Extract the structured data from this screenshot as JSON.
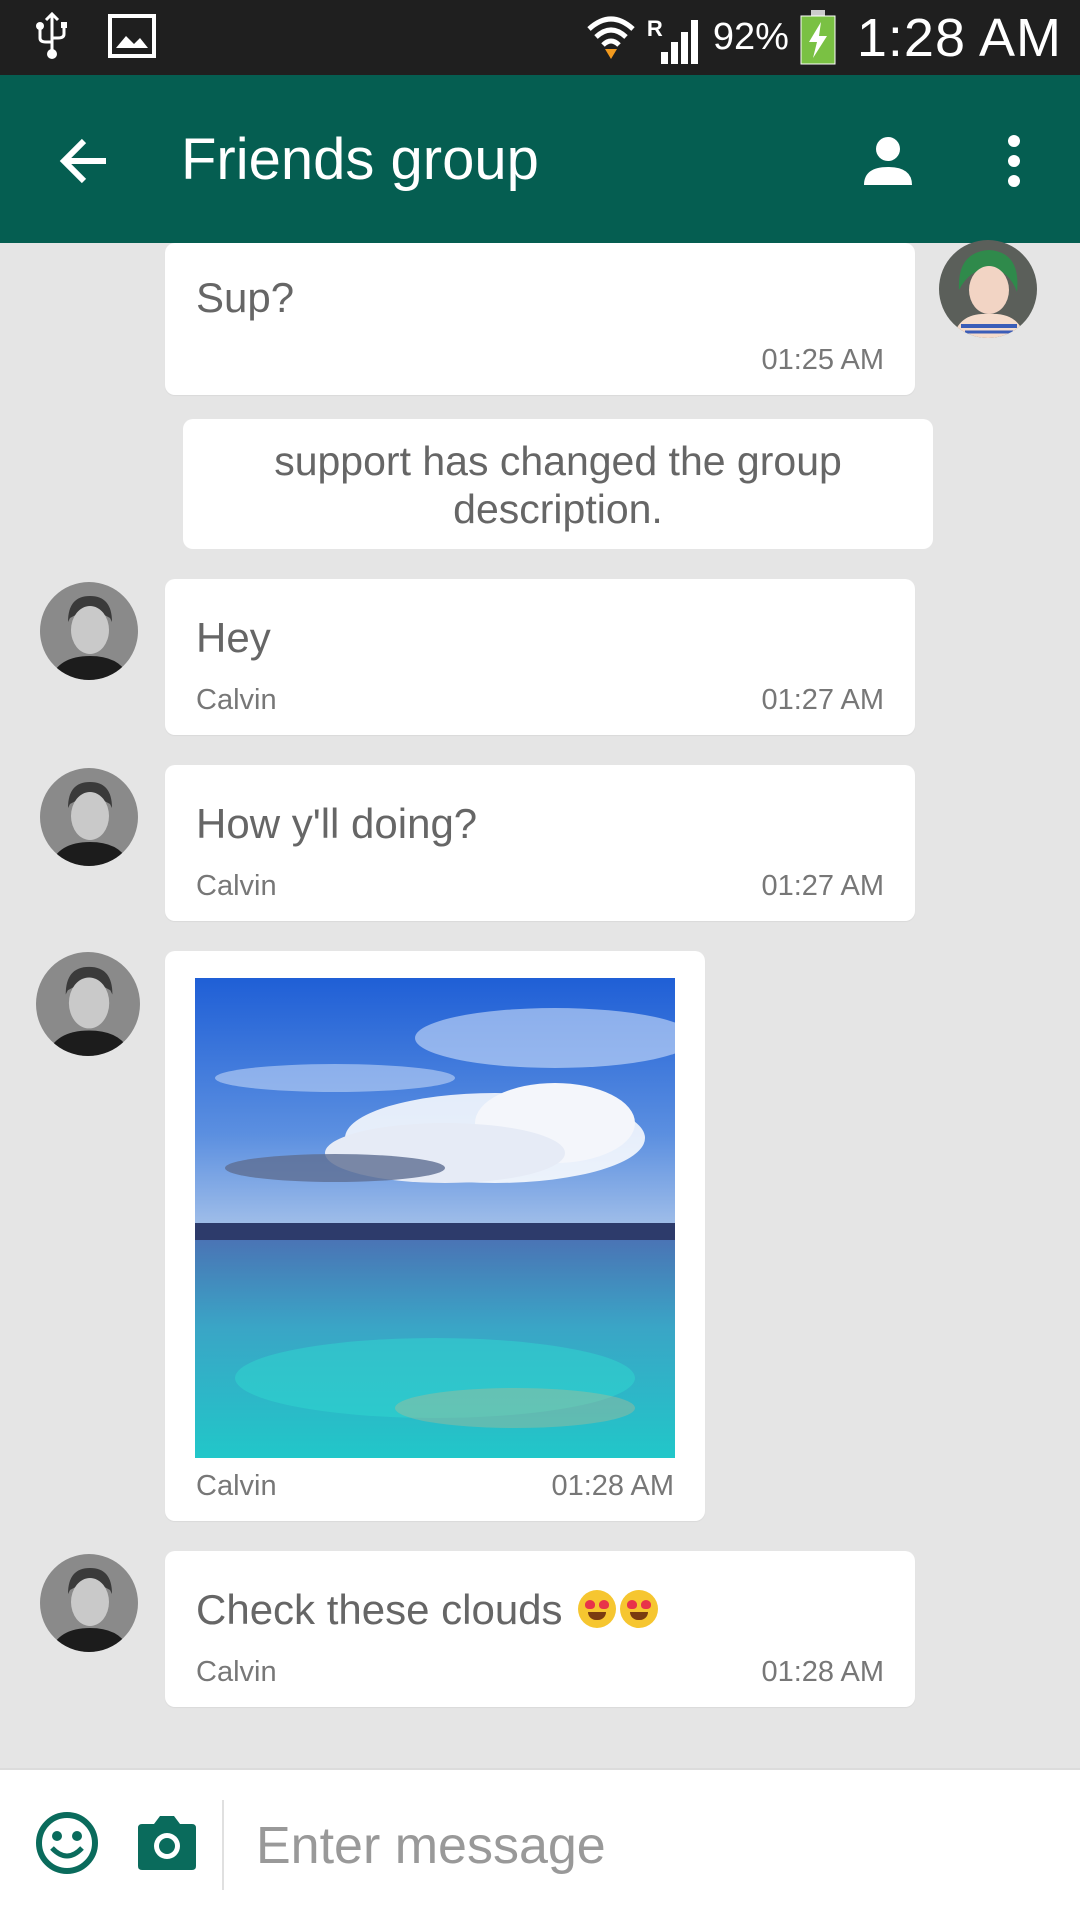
{
  "status_bar": {
    "battery": "92%",
    "time": "1:28 AM",
    "roaming": "R"
  },
  "header": {
    "title": "Friends group",
    "back_icon": "arrow-back-icon",
    "person_icon": "person-icon",
    "more_icon": "more-vert-icon"
  },
  "messages": [
    {
      "text": "Sup?",
      "time": "01:25 AM"
    },
    {
      "system_text": "support has changed the group description."
    },
    {
      "text": "Hey",
      "sender": "Calvin",
      "time": "01:27 AM"
    },
    {
      "text": "How y'll doing?",
      "sender": "Calvin",
      "time": "01:27 AM"
    },
    {
      "sender": "Calvin",
      "time": "01:28 AM"
    },
    {
      "text": "Check these clouds",
      "sender": "Calvin",
      "time": "01:28 AM"
    }
  ],
  "composer": {
    "placeholder": "Enter message"
  },
  "colors": {
    "app_bar": "#055e51",
    "status_bar": "#1f1f1f",
    "chat_background": "#e5e5e5",
    "icon_accent": "#0a6b5c"
  }
}
